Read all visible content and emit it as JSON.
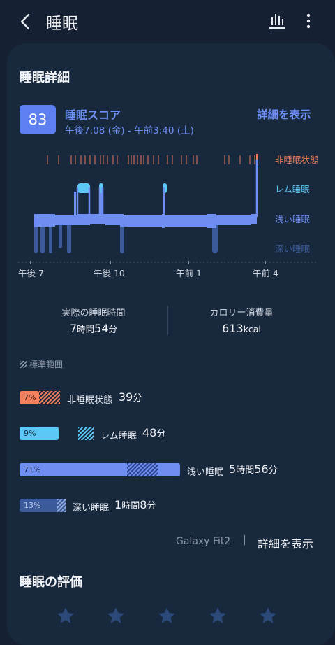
{
  "header": {
    "title": "睡眠"
  },
  "section": {
    "title": "睡眠詳細"
  },
  "score": {
    "value": "83",
    "label": "睡眠スコア",
    "time_range": "午後7:08 (金) - 午前3:40 (土)",
    "detail_link": "詳細を表示"
  },
  "hypnogram": {
    "stage_labels": [
      "非睡眠状態",
      "レム睡眠",
      "浅い睡眠",
      "深い睡眠"
    ],
    "stage_colors": [
      "#f47f5c",
      "#5bc8f5",
      "#6f8ef2",
      "#3b5a9a"
    ],
    "x_labels": [
      "午後 7",
      "午後 10",
      "午前 1",
      "午前 4"
    ]
  },
  "stats": {
    "actual_sleep_label": "実際の睡眠時間",
    "actual_sleep": {
      "h": "7",
      "h_unit": "時間",
      "m": "54",
      "m_unit": "分"
    },
    "calories_label": "カロリー消費量",
    "calories": {
      "value": "613",
      "unit": "kcal"
    }
  },
  "standard_range_label": "標準範囲",
  "breakdown": [
    {
      "pct": "7%",
      "fraction": 0.07,
      "label": "非睡眠状態",
      "value": "39",
      "unit": "分",
      "color": "#f47f5c"
    },
    {
      "pct": "9%",
      "fraction": 0.09,
      "label": "レム睡眠",
      "value": "48",
      "unit": "分",
      "color": "#5bc8f5"
    },
    {
      "pct": "71%",
      "fraction": 0.71,
      "label": "浅い睡眠",
      "h": "5",
      "h_unit": "時間",
      "value": "56",
      "unit": "分",
      "color": "#6f8ef2"
    },
    {
      "pct": "13%",
      "fraction": 0.13,
      "label": "深い睡眠",
      "h": "1",
      "h_unit": "時間",
      "value": "8",
      "unit": "分",
      "color": "#3b5a9a"
    }
  ],
  "device": {
    "name": "Galaxy Fit2",
    "separator": "|",
    "link": "詳細を表示"
  },
  "rating": {
    "title": "睡眠の評価",
    "stars": 5,
    "filled": 0
  }
}
